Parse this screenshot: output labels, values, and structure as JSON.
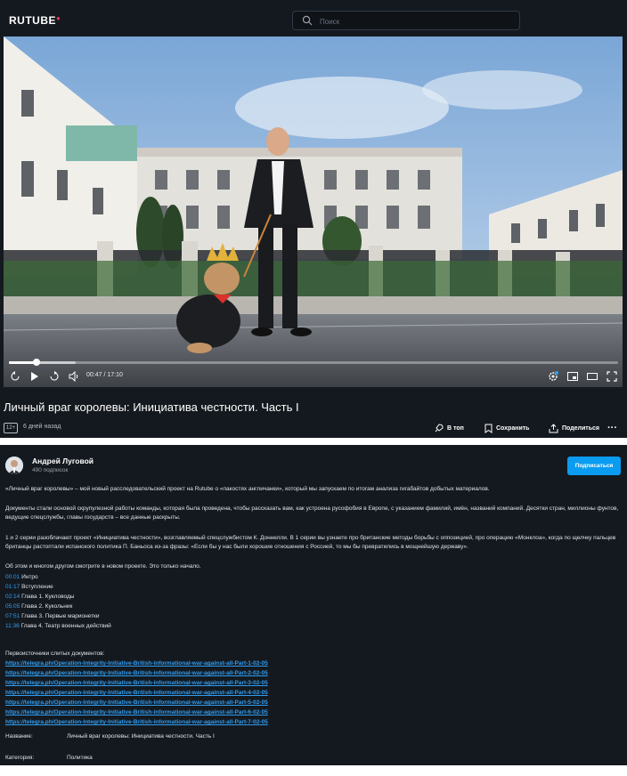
{
  "header": {
    "logo": "RUTUBE",
    "search_placeholder": "Поиск"
  },
  "player": {
    "time": "00:47 / 17:10",
    "progress": 0.046,
    "buffered": 0.11
  },
  "video": {
    "title": "Личный враг королевы: Инициатива честности. Часть I",
    "age_rating": "12+",
    "published": "6 дней назад",
    "actions": {
      "top": "В топ",
      "save": "Сохранить",
      "share": "Поделиться"
    }
  },
  "channel": {
    "name": "Андрей Луговой",
    "subscribers": "490 подписок",
    "subscribe_label": "Подписаться"
  },
  "description": {
    "p1": "«Личный враг королевы» – мой новый расследовательский проект на Rutube о «пакостях англичанки», который мы запускаем по итогам анализа гигабайтов добытых материалов.",
    "p2": "Документы стали основой скрупулезной работы команды, которая была проведена, чтобы рассказать вам, как устроена русофобия в Европе, с указанием фамилий, имён, названий компаний. Десятки стран, миллионы фунтов, ведущие спецслужбы, главы государств – все данные раскрыты.",
    "p3": "1 и 2 серии разоблачают проект «Инициатива честности», возглавляемый спецслужбистом К. Доннелли. В 1 серии вы узнаете про британские методы борьбы с оппозицией, про операцию «Монклоа», когда по щелчку пальцев британцы растоптали испанского политика П. Баньоса из-за фразы: «Если бы у нас были хорошие отношения с Россией, то мы бы превратились в мощнейшую державу».",
    "p4": "Об этом и многом другом смотрите в новом проекте. Это только начало.",
    "chapters": [
      {
        "t": "00:01",
        "label": "Интро"
      },
      {
        "t": "01:17",
        "label": "Вступление"
      },
      {
        "t": "02:14",
        "label": "Глава 1. Кукловоды"
      },
      {
        "t": "05:05",
        "label": "Глава 2. Кукольник"
      },
      {
        "t": "07:51",
        "label": "Глава 3. Первые марионетки"
      },
      {
        "t": "11:36",
        "label": "Глава 4. Театр военных действий"
      }
    ],
    "sources_heading": "Первоисточники слитых документов:",
    "links": [
      "https://telegra.ph/Operation-Integrity-Initiative-British-informational-war-against-all-Part-1-02-05",
      "https://telegra.ph/Operation-Integrity-Initiative-British-informational-war-against-all-Part-2-02-05",
      "https://telegra.ph/Operation-Integrity-Initiative-British-informational-war-against-all-Part-3-02-05",
      "https://telegra.ph/Operation-Integrity-Initiative-British-informational-war-against-all-Part-4-02-05",
      "https://telegra.ph/Operation-Integrity-Initiative-British-informational-war-against-all-Part-5-02-05",
      "https://telegra.ph/Operation-Integrity-Initiative-British-informational-war-against-all-Part-6-02-05",
      "https://telegra.ph/Operation-Integrity-Initiative-British-informational-war-against-all-Part-7-02-05"
    ]
  },
  "info": {
    "name_label": "Название:",
    "name_value": "Личный враг королевы: Инициатива честности. Часть I",
    "category_label": "Категория:",
    "category_value": "Политика"
  }
}
